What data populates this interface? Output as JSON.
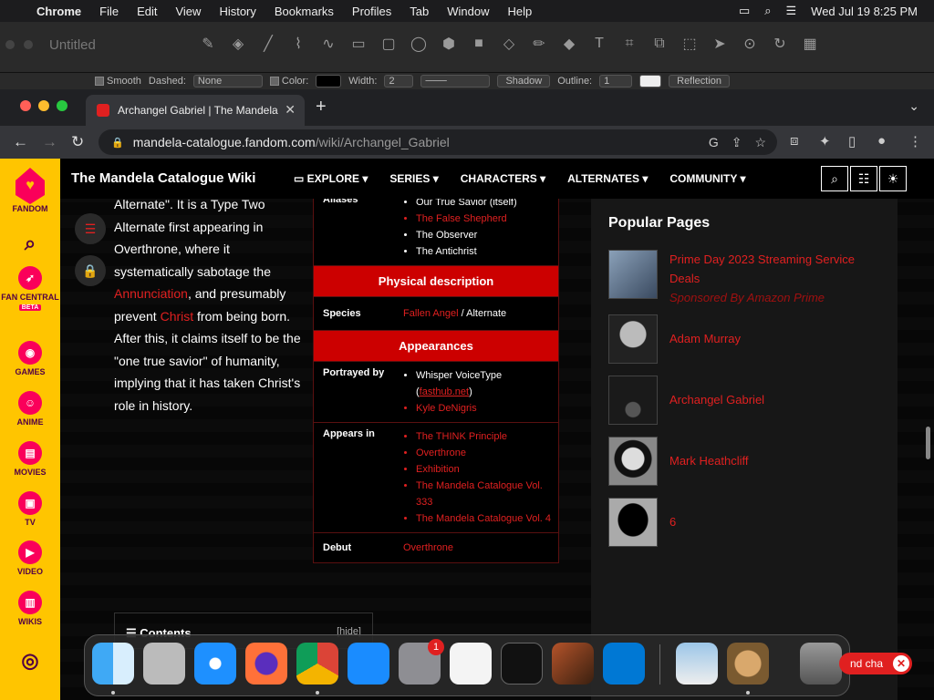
{
  "menubar": {
    "apple": "",
    "items": [
      "Chrome",
      "File",
      "Edit",
      "View",
      "History",
      "Bookmarks",
      "Profiles",
      "Tab",
      "Window",
      "Help"
    ],
    "datetime": "Wed Jul 19  8:25 PM"
  },
  "draw_app": {
    "title": "Untitled",
    "options": {
      "smooth": "Smooth",
      "dashed_label": "Dashed:",
      "dashed_value": "None",
      "color_label": "Color:",
      "width_label": "Width:",
      "width_value": "2",
      "shadow": "Shadow",
      "outline_label": "Outline:",
      "outline_value": "1",
      "reflection": "Reflection"
    }
  },
  "browser": {
    "tab_title": "Archangel Gabriel | The Mandela",
    "url_host": "mandela-catalogue.fandom.com",
    "url_path": "/wiki/Archangel_Gabriel"
  },
  "fandom_rail": {
    "brand": "FANDOM",
    "items": [
      {
        "label": "FAN CENTRAL",
        "badge": "BETA"
      },
      {
        "label": "GAMES"
      },
      {
        "label": "ANIME"
      },
      {
        "label": "MOVIES"
      },
      {
        "label": "TV"
      },
      {
        "label": "VIDEO"
      },
      {
        "label": "WIKIS"
      }
    ]
  },
  "wiki": {
    "name": "The Mandela Catalogue Wiki",
    "nav": [
      "EXPLORE ▾",
      "SERIES ▾",
      "CHARACTERS ▾",
      "ALTERNATES ▾",
      "COMMUNITY ▾"
    ]
  },
  "article": {
    "p1": "Alternate\". It is a Type Two Alternate first appearing in Overthrone, where it systematically sabotage the ",
    "link1": "Annunciation",
    "p2": ", and presumably prevent ",
    "link2": "Christ",
    "p3": " from being born. After this, it claims itself to be the \"one true savior\" of humanity, implying that it has taken Christ's role in history."
  },
  "infobox": {
    "aliases_label": "Aliases",
    "aliases": [
      "Our True Savior (itself)",
      "The False Shepherd",
      "The Observer",
      "The Antichrist"
    ],
    "physical_header": "Physical description",
    "species_label": "Species",
    "species_link": "Fallen Angel",
    "species_rest": " / Alternate",
    "appearances_header": "Appearances",
    "portrayed_label": "Portrayed by",
    "portrayed_1": "Whisper VoiceType",
    "portrayed_1_link": "fasthub.net",
    "portrayed_2": "Kyle DeNigris",
    "appears_label": "Appears in",
    "appears": [
      "The THINK Principle",
      "Overthrone",
      "Exhibition",
      "The Mandela Catalogue Vol. 333",
      "The Mandela Catalogue Vol. 4"
    ],
    "debut_label": "Debut",
    "debut": "Overthrone"
  },
  "contents": {
    "title": "Contents",
    "hide": "[hide]"
  },
  "sidebar": {
    "title": "Popular Pages",
    "pages": [
      {
        "title": "Prime Day 2023 Streaming Service Deals",
        "sponsor": "Sponsored By Amazon Prime"
      },
      {
        "title": "Adam Murray"
      },
      {
        "title": "Archangel Gabriel"
      },
      {
        "title": "Mark Heathcliff"
      },
      {
        "title": "6"
      }
    ]
  },
  "chat": {
    "label": "nd cha"
  },
  "dock": {
    "badge": "1"
  }
}
